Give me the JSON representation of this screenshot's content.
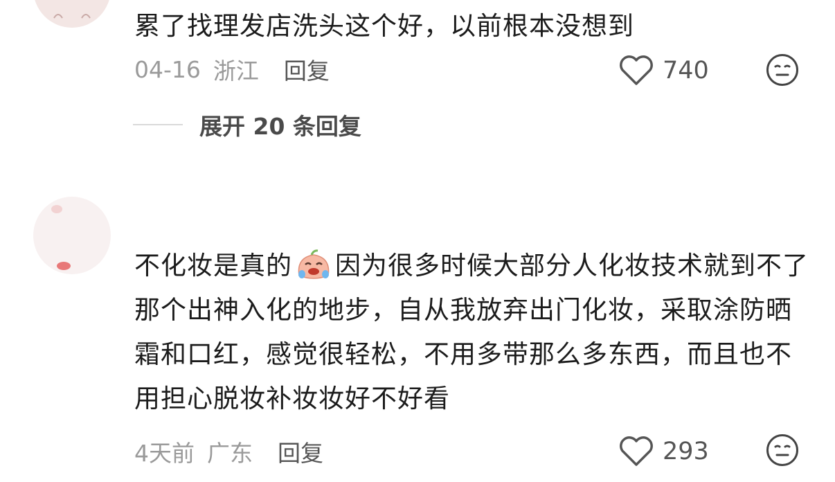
{
  "comments": [
    {
      "text": "累了找理发店洗头这个好，以前根本没想到",
      "date": "04-16",
      "location": "浙江",
      "reply_label": "回复",
      "likes": "740",
      "expand_label": "展开 20 条回复"
    },
    {
      "text_before_emoji": "不化妆是真的",
      "text_after_emoji": "因为很多时候大部分人化妆技术就到不了那个出神入化的地步，自从我放弃出门化妆，采取涂防晒霜和口红，感觉很轻松，不用多带那么多东西，而且也不用担心脱妆补妆妆好不好看",
      "date": "4天前",
      "location": "广东",
      "reply_label": "回复",
      "likes": "293"
    }
  ],
  "icons": {
    "like": "heart-outline-icon",
    "dislike": "neutral-face-icon",
    "inline_emoji": "crying-laughing-emoji"
  },
  "colors": {
    "text": "#1c1c1c",
    "meta": "#9a9a9a",
    "secondary": "#555555"
  }
}
